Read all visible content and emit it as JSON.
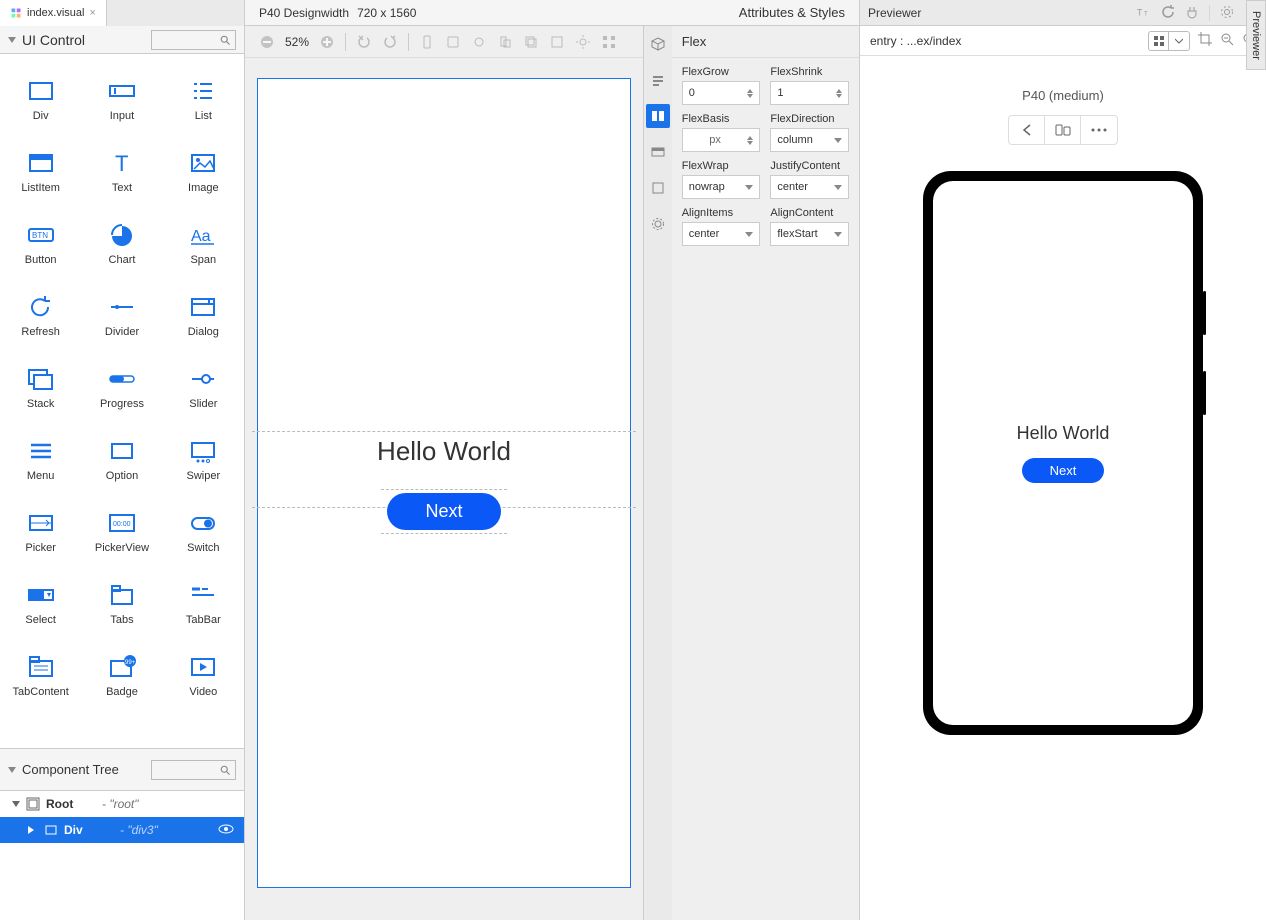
{
  "tab": {
    "name": "index.visual"
  },
  "uiControl": {
    "title": "UI Control"
  },
  "palette": [
    {
      "label": "Div"
    },
    {
      "label": "Input"
    },
    {
      "label": "List"
    },
    {
      "label": "ListItem"
    },
    {
      "label": "Text"
    },
    {
      "label": "Image"
    },
    {
      "label": "Button"
    },
    {
      "label": "Chart"
    },
    {
      "label": "Span"
    },
    {
      "label": "Refresh"
    },
    {
      "label": "Divider"
    },
    {
      "label": "Dialog"
    },
    {
      "label": "Stack"
    },
    {
      "label": "Progress"
    },
    {
      "label": "Slider"
    },
    {
      "label": "Menu"
    },
    {
      "label": "Option"
    },
    {
      "label": "Swiper"
    },
    {
      "label": "Picker"
    },
    {
      "label": "PickerView"
    },
    {
      "label": "Switch"
    },
    {
      "label": "Select"
    },
    {
      "label": "Tabs"
    },
    {
      "label": "TabBar"
    },
    {
      "label": "TabContent"
    },
    {
      "label": "Badge"
    },
    {
      "label": "Video"
    }
  ],
  "tree": {
    "title": "Component Tree",
    "root": {
      "type": "Root",
      "id": "- \"root\""
    },
    "div": {
      "type": "Div",
      "id": "- \"div3\""
    }
  },
  "designHeader": {
    "device": "P40 Designwidth",
    "dims": "720 x 1560",
    "attrs": "Attributes & Styles"
  },
  "zoom": "52%",
  "canvas": {
    "hello": "Hello World",
    "next": "Next"
  },
  "propsTitle": "Flex",
  "props": {
    "flexGrow": {
      "label": "FlexGrow",
      "value": "0"
    },
    "flexShrink": {
      "label": "FlexShrink",
      "value": "1"
    },
    "flexBasis": {
      "label": "FlexBasis",
      "value": "",
      "unit": "px"
    },
    "flexDirection": {
      "label": "FlexDirection",
      "value": "column"
    },
    "flexWrap": {
      "label": "FlexWrap",
      "value": "nowrap"
    },
    "justifyContent": {
      "label": "JustifyContent",
      "value": "center"
    },
    "alignItems": {
      "label": "AlignItems",
      "value": "center"
    },
    "alignContent": {
      "label": "AlignContent",
      "value": "flexStart"
    }
  },
  "previewer": {
    "title": "Previewer",
    "entry": "entry : ...ex/index",
    "device": "P40 (medium)",
    "hello": "Hello World",
    "next": "Next",
    "sideTab": "Previewer"
  }
}
